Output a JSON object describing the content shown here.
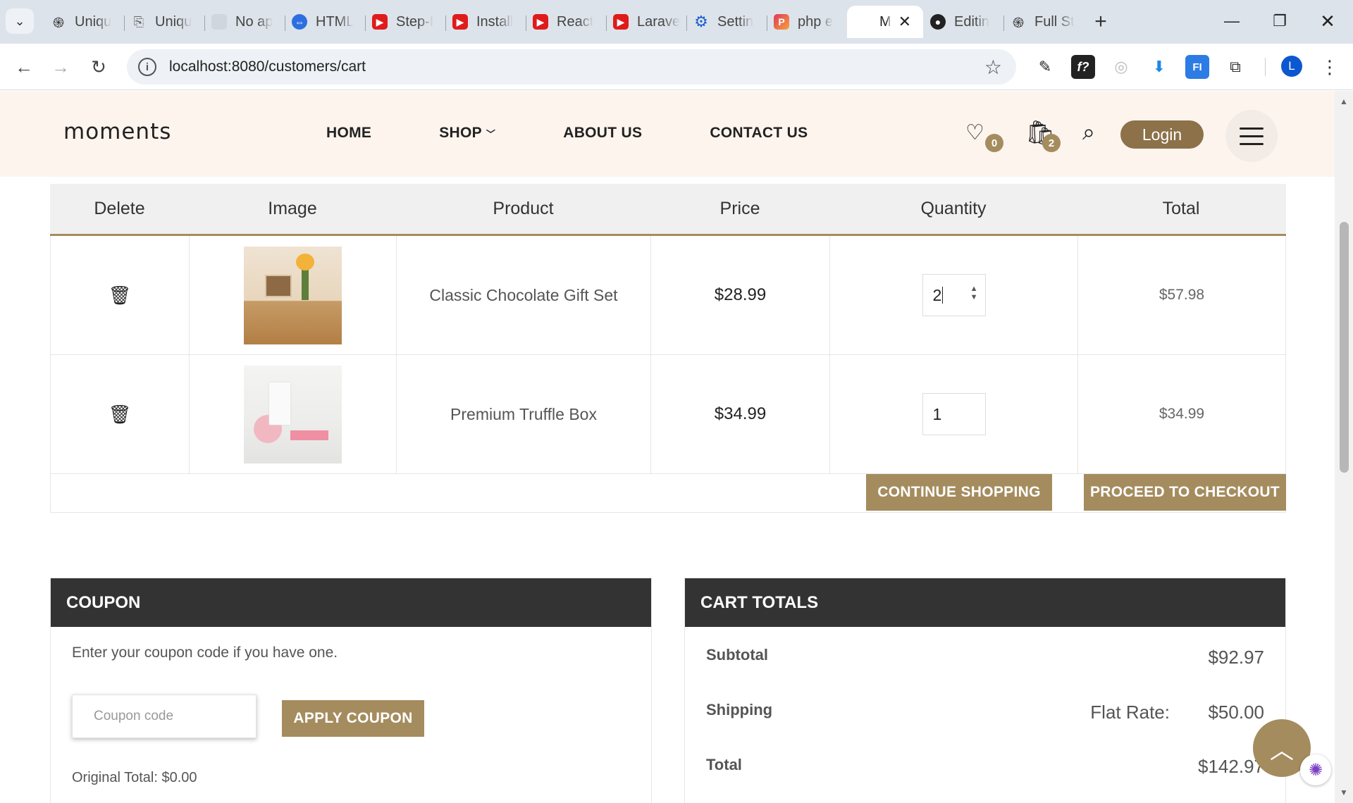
{
  "browser": {
    "tabs": [
      {
        "label": "Uniqu",
        "icon": "openai-icon"
      },
      {
        "label": "Uniqu",
        "icon": "doc-icon"
      },
      {
        "label": "No ap",
        "icon": "blank-icon"
      },
      {
        "label": "HTML",
        "icon": "globe-icon"
      },
      {
        "label": "Step-I",
        "icon": "youtube-icon"
      },
      {
        "label": "Install",
        "icon": "youtube-icon"
      },
      {
        "label": "React",
        "icon": "youtube-icon"
      },
      {
        "label": "Larave",
        "icon": "youtube-icon"
      },
      {
        "label": "Settin",
        "icon": "gear-icon"
      },
      {
        "label": "php e",
        "icon": "phpstorm-icon"
      },
      {
        "label": "M",
        "icon": "blank-icon",
        "active": true
      },
      {
        "label": "Editin",
        "icon": "github-icon"
      },
      {
        "label": "Full St",
        "icon": "openai-icon"
      }
    ],
    "url": "localhost:8080/customers/cart",
    "profile_initial": "L"
  },
  "header": {
    "logo": "moments",
    "menu": [
      "HOME",
      "SHOP",
      "ABOUT US",
      "CONTACT US"
    ],
    "wishlist_count": "0",
    "cart_count": "2",
    "login_label": "Login"
  },
  "cart": {
    "columns": [
      "Delete",
      "Image",
      "Product",
      "Price",
      "Quantity",
      "Total"
    ],
    "rows": [
      {
        "product": "Classic Chocolate Gift Set",
        "price": "$28.99",
        "quantity": "2",
        "total": "$57.98"
      },
      {
        "product": "Premium Truffle Box",
        "price": "$34.99",
        "quantity": "1",
        "total": "$34.99"
      }
    ],
    "continue_label": "CONTINUE SHOPPING",
    "checkout_label": "PROCEED TO CHECKOUT"
  },
  "coupon": {
    "title": "COUPON",
    "text": "Enter your coupon code if you have one.",
    "placeholder": "Coupon code",
    "apply_label": "APPLY COUPON",
    "original_total": "Original Total: $0.00"
  },
  "totals": {
    "title": "CART TOTALS",
    "subtotal_label": "Subtotal",
    "subtotal_value": "$92.97",
    "shipping_label": "Shipping",
    "shipping_method": "Flat Rate:",
    "shipping_value": "$50.00",
    "total_label": "Total",
    "total_value": "$142.97"
  },
  "colors": {
    "accent": "#a58c5e",
    "login": "#8c7149",
    "header_bg": "#fdf4ee",
    "panel_head": "#333333"
  }
}
